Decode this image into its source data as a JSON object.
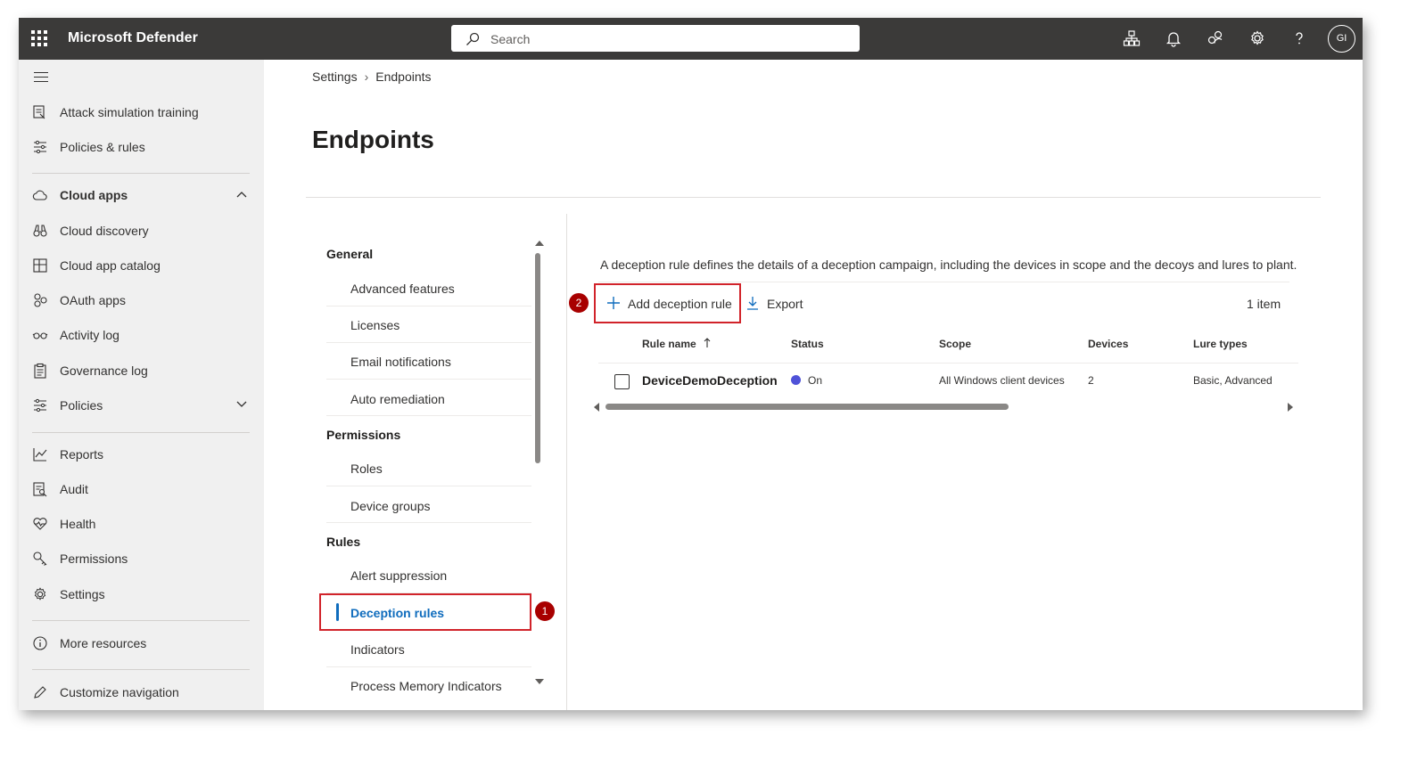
{
  "app": {
    "title": "Microsoft Defender",
    "search_placeholder": "Search",
    "avatar_initials": "GI",
    "topbar_icons": [
      "org-chart-icon",
      "bell-icon",
      "community-icon",
      "gear-icon",
      "help-icon"
    ]
  },
  "sidebar": {
    "items": [
      {
        "label": "Attack simulation training",
        "icon": "simulation-icon"
      },
      {
        "label": "Policies & rules",
        "icon": "sliders-icon"
      },
      {
        "label": "Cloud apps",
        "icon": "cloud-icon",
        "expanded": true
      },
      {
        "label": "Cloud discovery",
        "icon": "binoculars-icon"
      },
      {
        "label": "Cloud app catalog",
        "icon": "catalog-icon"
      },
      {
        "label": "OAuth apps",
        "icon": "oauth-icon"
      },
      {
        "label": "Activity log",
        "icon": "glasses-icon"
      },
      {
        "label": "Governance log",
        "icon": "clipboard-icon"
      },
      {
        "label": "Policies",
        "icon": "sliders-icon",
        "expanded": false
      },
      {
        "label": "Reports",
        "icon": "chart-icon"
      },
      {
        "label": "Audit",
        "icon": "audit-icon"
      },
      {
        "label": "Health",
        "icon": "heart-icon"
      },
      {
        "label": "Permissions",
        "icon": "key-icon"
      },
      {
        "label": "Settings",
        "icon": "gear-icon"
      },
      {
        "label": "More resources",
        "icon": "info-icon"
      },
      {
        "label": "Customize navigation",
        "icon": "pencil-icon"
      }
    ]
  },
  "breadcrumb": {
    "items": [
      "Settings",
      "Endpoints"
    ]
  },
  "page": {
    "title": "Endpoints"
  },
  "settings_nav": {
    "general_heading": "General",
    "general_items": [
      "Advanced features",
      "Licenses",
      "Email notifications",
      "Auto remediation"
    ],
    "permissions_heading": "Permissions",
    "permissions_items": [
      "Roles",
      "Device groups"
    ],
    "rules_heading": "Rules",
    "rules_items": [
      "Alert suppression",
      "Deception rules",
      "Indicators",
      "Process Memory Indicators"
    ],
    "active_item": "Deception rules"
  },
  "annotations": {
    "step1": "1",
    "step2": "2",
    "highlight_color": "#d1232a"
  },
  "content": {
    "description": "A deception rule defines the details of a deception campaign, including the devices in scope and the decoys and lures to plant.",
    "add_button": "Add deception rule",
    "export_button": "Export",
    "item_count": "1 item",
    "table": {
      "columns": [
        "Rule name",
        "Status",
        "Scope",
        "Devices",
        "Lure types"
      ],
      "sort_column": "Rule name",
      "rows": [
        {
          "rule_name": "DeviceDemoDeception",
          "status": "On",
          "scope": "All Windows client devices",
          "devices": "2",
          "lure_types": "Basic, Advanced"
        }
      ]
    }
  },
  "colors": {
    "topbar": "#3b3a39",
    "sidebar": "#f0f0f0",
    "accent": "#0f6cbd",
    "status_on": "#4f52d8"
  }
}
